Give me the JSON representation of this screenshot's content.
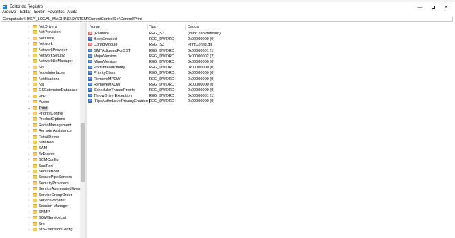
{
  "window": {
    "title": "Editor do Registro",
    "controls": {
      "minimize": "—",
      "maximize": "",
      "close": "✕"
    }
  },
  "menu": [
    "Arquivo",
    "Editar",
    "Exibir",
    "Favoritos",
    "Ajuda"
  ],
  "address": "Computador\\HKEY_LOCAL_MACHINE\\SYSTEM\\CurrentControlSet\\Control\\Print",
  "tree": {
    "items": [
      "NetDrivers",
      "NetProvision",
      "NetTrace",
      "Network",
      "NetworkProvider",
      "NetworkSetup2",
      "NetworkUxManager",
      "Nls",
      "NodeInterfaces",
      "Notifications",
      "Nsi",
      "OSExtensionDatabase",
      "PnP",
      "Power",
      "Print"
    ],
    "selected": "Print",
    "children": [
      "PriorityControl",
      "ProductOptions",
      "RadioManagement",
      "Remote Assistance",
      "RetailDemo",
      "SafeBoot",
      "SAM",
      "ScEvents",
      "SCMConfig",
      "ScsiPort",
      "SecureBoot",
      "SecurePipeServers",
      "SecurityProviders",
      "ServiceAggregatedEvent",
      "ServiceGroupOrder",
      "ServiceProvider",
      "Session Manager",
      "SNMP",
      "SQMServiceList",
      "Srp",
      "SrpExtensionConfig"
    ]
  },
  "columns": {
    "name": "Nome",
    "type": "Tipo",
    "data": "Dados"
  },
  "values": [
    {
      "icon": "string-value-icon",
      "name": "(Padrão)",
      "type": "REG_SZ",
      "data": "(valor não definido)"
    },
    {
      "icon": "binary-value-icon",
      "name": "BeepEnabled",
      "type": "REG_DWORD",
      "data": "0x00000000 (0)"
    },
    {
      "icon": "string-value-icon",
      "name": "ConfigModule",
      "type": "REG_SZ",
      "data": "PrintConfig.dll"
    },
    {
      "icon": "binary-value-icon",
      "name": "GMTAdjustedForDST",
      "type": "REG_DWORD",
      "data": "0x00000001 (1)"
    },
    {
      "icon": "binary-value-icon",
      "name": "MajorVersion",
      "type": "REG_DWORD",
      "data": "0x00000002 (2)"
    },
    {
      "icon": "binary-value-icon",
      "name": "MinorVersion",
      "type": "REG_DWORD",
      "data": "0x00000000 (0)"
    },
    {
      "icon": "binary-value-icon",
      "name": "PortThreadPriority",
      "type": "REG_DWORD",
      "data": "0x00000000 (0)"
    },
    {
      "icon": "binary-value-icon",
      "name": "PriorityClass",
      "type": "REG_DWORD",
      "data": "0x00000000 (0)"
    },
    {
      "icon": "binary-value-icon",
      "name": "RemoveMPDW",
      "type": "REG_DWORD",
      "data": "0x00000000 (0)"
    },
    {
      "icon": "binary-value-icon",
      "name": "RemoveMXDW",
      "type": "REG_DWORD",
      "data": "0x00000000 (0)"
    },
    {
      "icon": "binary-value-icon",
      "name": "SchedulerThreadPriority",
      "type": "REG_DWORD",
      "data": "0x00000000 (0)"
    },
    {
      "icon": "binary-value-icon",
      "name": "ThrowDriverException",
      "type": "REG_DWORD",
      "data": "0x00000001 (1)"
    },
    {
      "icon": "binary-value-icon",
      "name": "RpcAuthnLevelPrivacyEnabled",
      "type": "REG_DWORD",
      "data": "0x00000000 (0)",
      "editing": true
    }
  ]
}
